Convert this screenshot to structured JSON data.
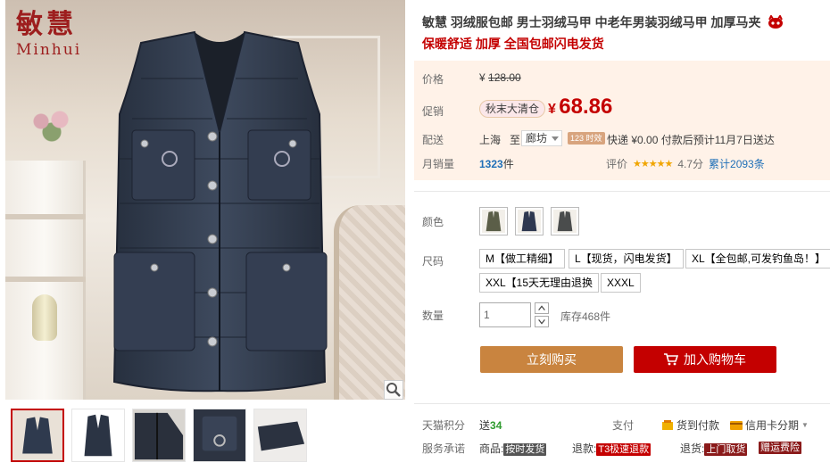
{
  "brand": {
    "name_cn": "敏慧",
    "name_en": "Minhui"
  },
  "product": {
    "title": "敏慧 羽绒服包邮 男士羽绒马甲 中老年男装羽绒马甲 加厚马夹",
    "subtitle": "保暖舒适 加厚 全国包邮闪电发货"
  },
  "price": {
    "label": "价格",
    "currency": "¥",
    "original": "128.00",
    "promo_label": "促销",
    "promo_badge": "秋末大清仓",
    "current": "68.86"
  },
  "shipping": {
    "label": "配送",
    "from": "上海",
    "to_word": "至",
    "destination": "廊坊",
    "hour_badge": "123 时效",
    "info": "快递 ¥0.00 付款后预计11月7日送达"
  },
  "sales": {
    "label": "月销量",
    "count": "1323",
    "unit": "件",
    "rating_label": "评价",
    "stars": "★★★★★",
    "score": "4.7分",
    "total": "累计2093条"
  },
  "colors": {
    "label": "颜色",
    "swatches": [
      {
        "name": "olive",
        "color": "#5b5e48"
      },
      {
        "name": "navy",
        "color": "#2e3850"
      },
      {
        "name": "gray",
        "color": "#4a4c4c"
      }
    ]
  },
  "sizes": {
    "label": "尺码",
    "options": [
      "M【做工精细】",
      "L【现货，闪电发货】",
      "XL【全包邮,可发钓鱼岛！】",
      "XXL【15天无理由退换",
      "XXXL"
    ]
  },
  "quantity": {
    "label": "数量",
    "value": "1",
    "stock": "库存468件"
  },
  "actions": {
    "buy_now": "立刻购买",
    "add_cart": "加入购物车"
  },
  "points": {
    "label": "天猫积分",
    "prefix": "送",
    "value": "34"
  },
  "payment": {
    "label": "支付",
    "cod": "货到付款",
    "installment": "信用卡分期",
    "installment_caret": "▼"
  },
  "service": {
    "label": "服务承诺",
    "goods_prefix": "商品:",
    "goods_tag": "按时发货",
    "refund_prefix": "退款:",
    "refund_tag": "T3极速退款",
    "return_prefix": "退货:",
    "return_tag": "上门取货",
    "insurance_tag": "赠运费险"
  },
  "icons": {
    "zoom": "magnifier-icon",
    "cart": "cart-icon",
    "tmall": "tmall-cat-icon"
  },
  "accent_colors": {
    "price_red": "#c40000",
    "buy_orange": "#c9843f",
    "link_blue": "#1e6fb7",
    "price_bg": "#fff2e8"
  }
}
